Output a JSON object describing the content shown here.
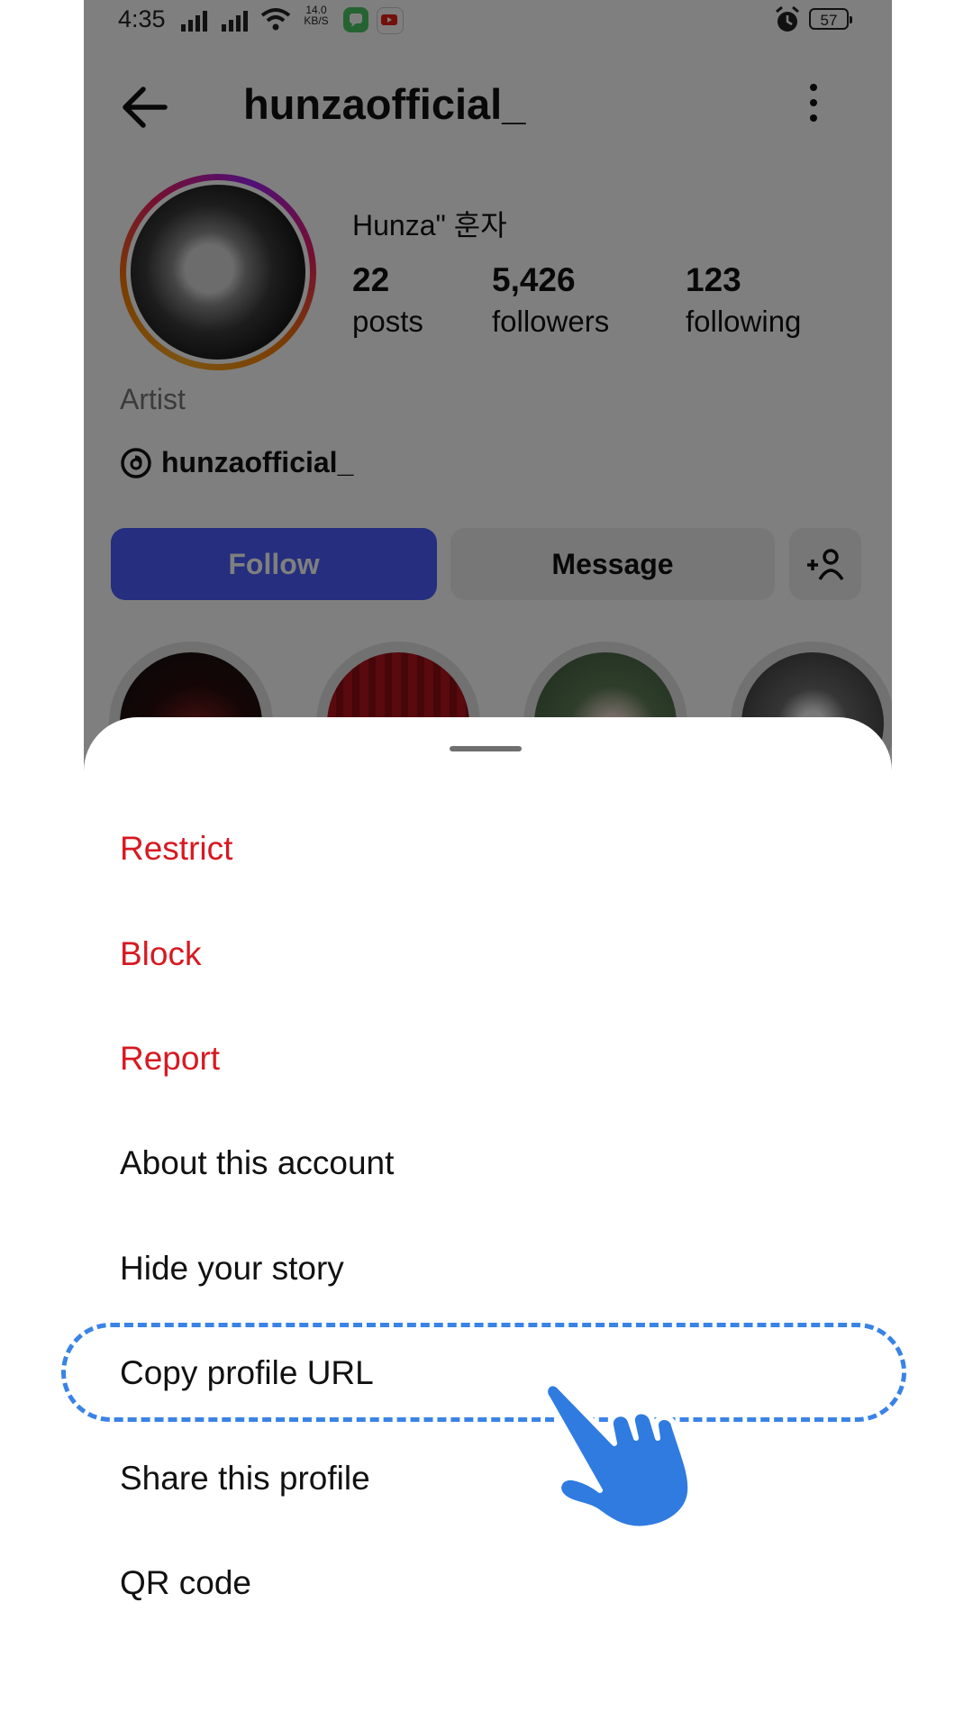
{
  "status_bar": {
    "time": "4:35",
    "net_speed_value": "14.0",
    "net_speed_unit": "KB/S",
    "battery": "57"
  },
  "header": {
    "username": "hunzaofficial_"
  },
  "profile": {
    "display_name": "Hunza\" 훈자",
    "stats": [
      {
        "value": "22",
        "label": "posts"
      },
      {
        "value": "5,426",
        "label": "followers"
      },
      {
        "value": "123",
        "label": "following"
      }
    ],
    "category": "Artist",
    "threads_handle": "hunzaofficial_"
  },
  "actions": {
    "follow_label": "Follow",
    "message_label": "Message",
    "add_user_icon": "add-person-icon"
  },
  "sheet": {
    "items": [
      {
        "label": "Restrict",
        "style": "danger"
      },
      {
        "label": "Block",
        "style": "danger"
      },
      {
        "label": "Report",
        "style": "danger"
      },
      {
        "label": "About this account",
        "style": "normal"
      },
      {
        "label": "Hide your story",
        "style": "normal"
      },
      {
        "label": "Copy profile URL",
        "style": "normal",
        "highlighted": true
      },
      {
        "label": "Share this profile",
        "style": "normal"
      },
      {
        "label": "QR code",
        "style": "normal"
      }
    ]
  },
  "colors": {
    "follow_button": "#4a5cff",
    "danger_text": "#d71921",
    "focus_ring": "#3a83e6",
    "hand_pointer": "#2f7be0",
    "scrim": "rgba(0,0,0,0.5)"
  }
}
